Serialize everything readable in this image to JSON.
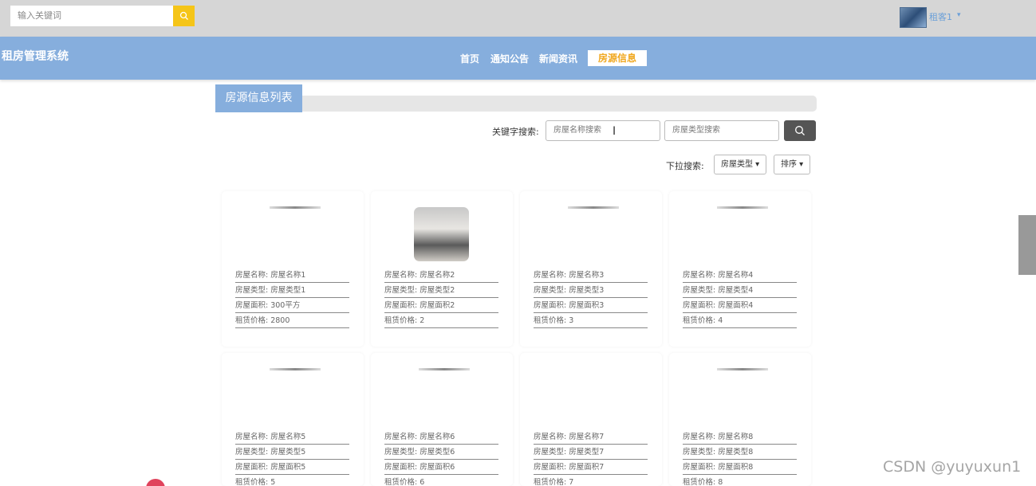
{
  "topbar": {
    "search_placeholder": "输入关键词",
    "user_name": "租客1",
    "user_caret": "▾"
  },
  "nav": {
    "brand": "租房管理系统",
    "items": [
      "首页",
      "通知公告",
      "新闻资讯",
      "房源信息"
    ],
    "active": "房源信息"
  },
  "panel": {
    "title": "房源信息列表",
    "keyword_label": "关键字搜索:",
    "name_placeholder": "房屋名称搜索",
    "type_placeholder": "房屋类型搜索",
    "dropdown_label": "下拉搜索:",
    "type_dropdown": "房屋类型 ▾",
    "sort_dropdown": "排序 ▾"
  },
  "cards": [
    {
      "name": "房屋名称: 房屋名称1",
      "type": "房屋类型: 房屋类型1",
      "area": "房屋面积: 300平方",
      "price": "租赁价格: 2800"
    },
    {
      "name": "房屋名称: 房屋名称2",
      "type": "房屋类型: 房屋类型2",
      "area": "房屋面积: 房屋面积2",
      "price": "租赁价格: 2"
    },
    {
      "name": "房屋名称: 房屋名称3",
      "type": "房屋类型: 房屋类型3",
      "area": "房屋面积: 房屋面积3",
      "price": "租赁价格: 3"
    },
    {
      "name": "房屋名称: 房屋名称4",
      "type": "房屋类型: 房屋类型4",
      "area": "房屋面积: 房屋面积4",
      "price": "租赁价格: 4"
    },
    {
      "name": "房屋名称: 房屋名称5",
      "type": "房屋类型: 房屋类型5",
      "area": "房屋面积: 房屋面积5",
      "price": "租赁价格: 5"
    },
    {
      "name": "房屋名称: 房屋名称6",
      "type": "房屋类型: 房屋类型6",
      "area": "房屋面积: 房屋面积6",
      "price": "租赁价格: 6"
    },
    {
      "name": "房屋名称: 房屋名称7",
      "type": "房屋类型: 房屋类型7",
      "area": "房屋面积: 房屋面积7",
      "price": "租赁价格: 7"
    },
    {
      "name": "房屋名称: 房屋名称8",
      "type": "房屋类型: 房屋类型8",
      "area": "房屋面积: 房屋面积8",
      "price": "租赁价格: 8"
    }
  ],
  "watermark": "CSDN @yuyuxun1",
  "colors": {
    "nav_bg": "#86aedd",
    "accent": "#f5c518",
    "active_text": "#f0a820",
    "topbar_bg": "#d6d6d6"
  }
}
